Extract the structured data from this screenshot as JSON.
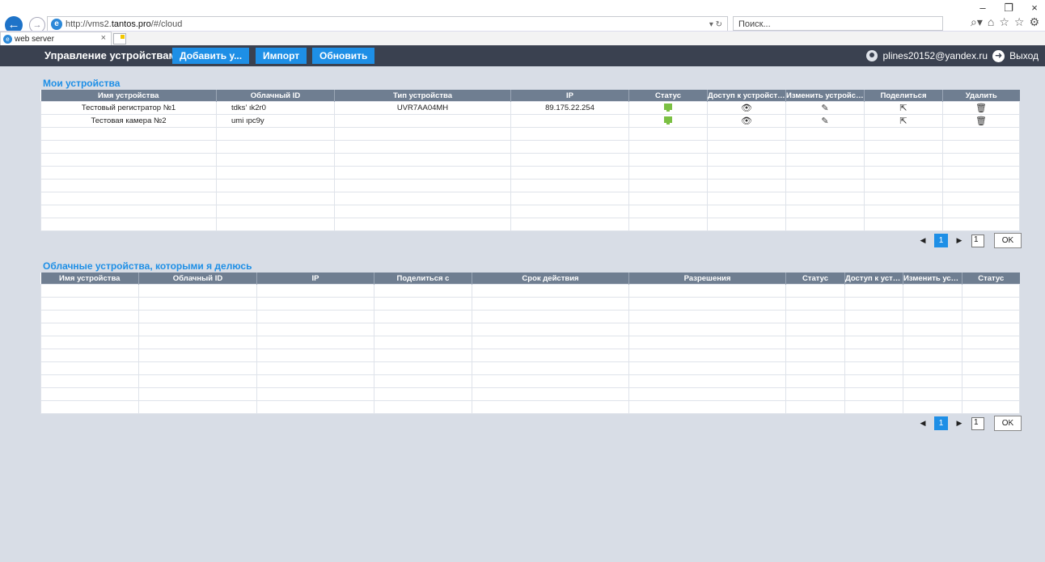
{
  "window": {
    "minimize": "–",
    "restore": "❐",
    "close": "×"
  },
  "browser": {
    "url_prefix": "http://vms2.",
    "url_host": "tantos.pro",
    "url_suffix": "/#/cloud",
    "search_placeholder": "Поиск...",
    "tab_title": "web server",
    "tab_close": "×"
  },
  "appbar": {
    "title": "Управление устройствами",
    "add_label": "Добавить у...",
    "import_label": "Импорт",
    "refresh_label": "Обновить",
    "user_email": "plines20152@yandex.ru",
    "logout_label": "Выход"
  },
  "my_devices": {
    "title": "Мои устройства",
    "columns": [
      "Имя устройства",
      "Облачный ID",
      "Тип устройства",
      "IP",
      "Статус",
      "Доступ к устройству",
      "Изменить устройство",
      "Поделиться",
      "Удалить"
    ],
    "rows": [
      {
        "name": "Тестовый регистратор №1",
        "cloud_id": "tdks’   ık2r0",
        "type": "UVR7AA04MH",
        "ip": "89.175.22.254",
        "status": "online"
      },
      {
        "name": "Тестовая камера №2",
        "cloud_id": "umi      ıpc9y",
        "type": "",
        "ip": "",
        "status": "online"
      }
    ],
    "pager": {
      "page": "1",
      "input_value": "1",
      "ok_label": "OK"
    }
  },
  "shared_devices": {
    "title": "Облачные устройства, которыми я делюсь",
    "columns": [
      "Имя устройства",
      "Облачный ID",
      "IP",
      "Поделиться с",
      "Срок действия",
      "Разрешения",
      "Статус",
      "Доступ к устро...",
      "Изменить устр...",
      "Статус"
    ],
    "pager": {
      "page": "1",
      "input_value": "1",
      "ok_label": "OK"
    }
  }
}
